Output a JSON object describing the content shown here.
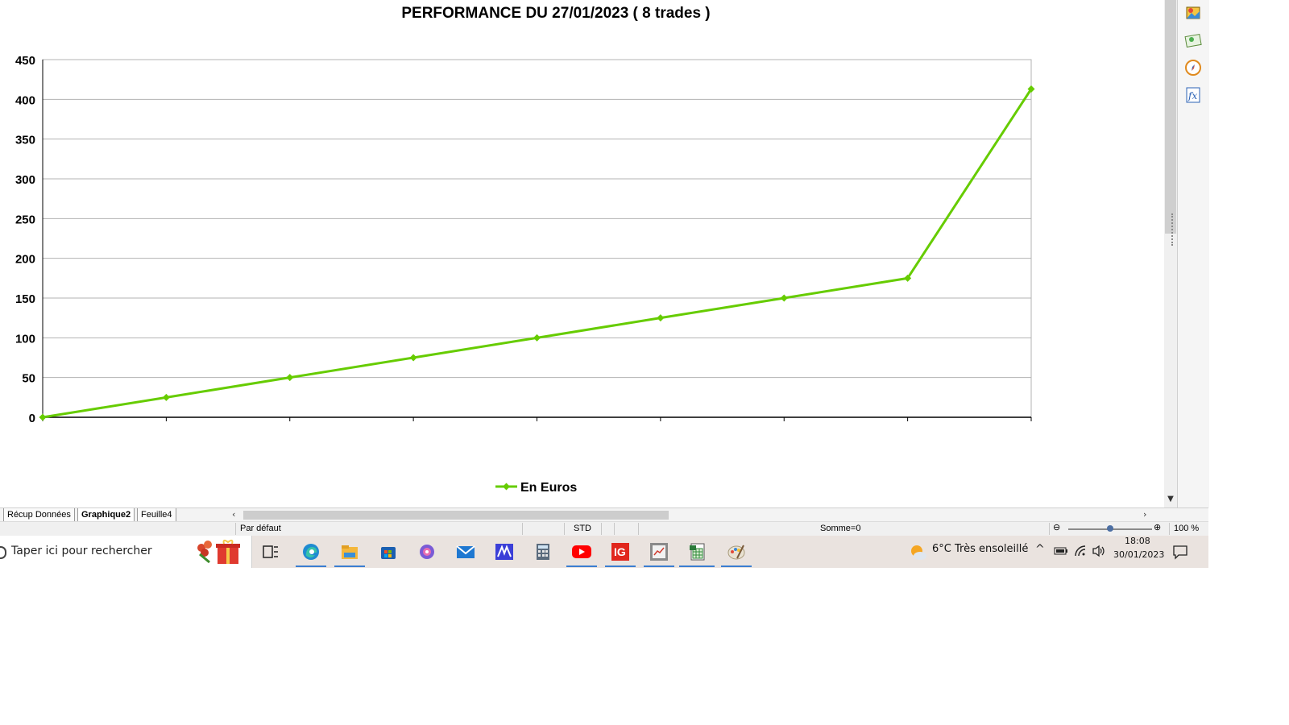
{
  "colors": {
    "series": "#66cc00",
    "grid": "#b3b3b3",
    "axis": "#000000",
    "taskbar_bg": "#eae3df",
    "accent": "#3b7ed1"
  },
  "chart_data": {
    "type": "line",
    "title": "PERFORMANCE DU 27/01/2023 ( 8 trades )",
    "xlabel": "",
    "ylabel": "",
    "x": [
      0,
      1,
      2,
      3,
      4,
      5,
      6,
      7,
      8
    ],
    "ylim": [
      0,
      450
    ],
    "yticks": [
      0,
      50,
      100,
      150,
      200,
      250,
      300,
      350,
      400,
      450
    ],
    "grid": true,
    "legend_position": "bottom",
    "series": [
      {
        "name": "En Euros",
        "values": [
          0,
          25,
          50,
          75,
          100,
          125,
          150,
          175,
          413
        ],
        "marker": "diamond"
      }
    ]
  },
  "sheet_tabs": [
    {
      "label": "Récup Données",
      "active": false
    },
    {
      "label": "Graphique2",
      "active": true
    },
    {
      "label": "Feuille4",
      "active": false
    }
  ],
  "statusbar": {
    "page_style": "Par défaut",
    "mode": "STD",
    "sum": "Somme=0",
    "zoom": "100 %"
  },
  "sidebar_icons": [
    "gallery-icon",
    "navigator-icon",
    "compass-icon",
    "functions-icon"
  ],
  "taskbar": {
    "search_placeholder": "Taper ici pour rechercher",
    "apps": [
      "task-view-icon",
      "edge-icon",
      "file-explorer-icon",
      "store-icon",
      "copilot-icon",
      "mail-icon",
      "app-m-icon",
      "calculator-icon",
      "youtube-icon",
      "ig-icon",
      "chart-app-icon",
      "calc-sheet-icon",
      "paint-icon"
    ],
    "ig_label": "IG",
    "weather": "6°C  Très ensoleillé",
    "time": "18:08",
    "date": "30/01/2023"
  }
}
